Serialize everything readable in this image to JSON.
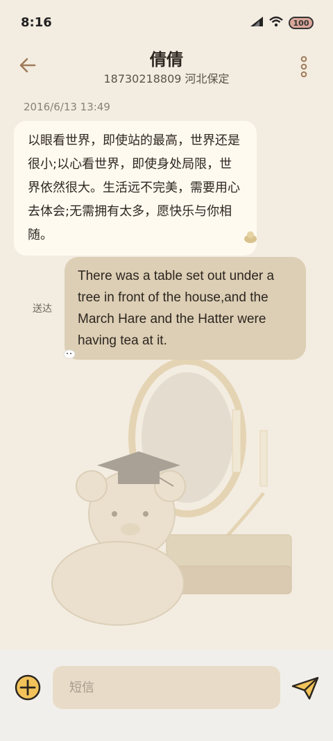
{
  "status_bar": {
    "time": "8:16",
    "battery_level": "100",
    "icons": [
      "signal-icon",
      "wifi-icon",
      "battery-icon"
    ]
  },
  "header": {
    "contact_name": "倩倩",
    "contact_detail": "18730218809 河北保定",
    "back_icon": "back-arrow-icon",
    "menu_icon": "more-vertical-icon"
  },
  "conversation": {
    "timestamp": "2016/6/13 13:49",
    "messages": [
      {
        "direction": "incoming",
        "text": "以眼看世界，即使站的最高，世界还是很小;以心看世界，即使身处局限，世界依然很大。生活远不完美，需要用心去体会;无需拥有太多，愿快乐与你相随。"
      },
      {
        "direction": "outgoing",
        "status": "送达",
        "text": "There was a table set out under a tree in front of the house,and the March Hare and the Hatter were having tea at it."
      }
    ]
  },
  "composer": {
    "placeholder": "短信",
    "value": "",
    "add_icon": "plus-circle-icon",
    "send_icon": "send-icon"
  },
  "colors": {
    "background": "#f3ece1",
    "incoming_bubble": "#fffaf0",
    "outgoing_bubble": "#ddcfb5",
    "accent": "#a07a58",
    "input_background": "#e8dcc8"
  }
}
